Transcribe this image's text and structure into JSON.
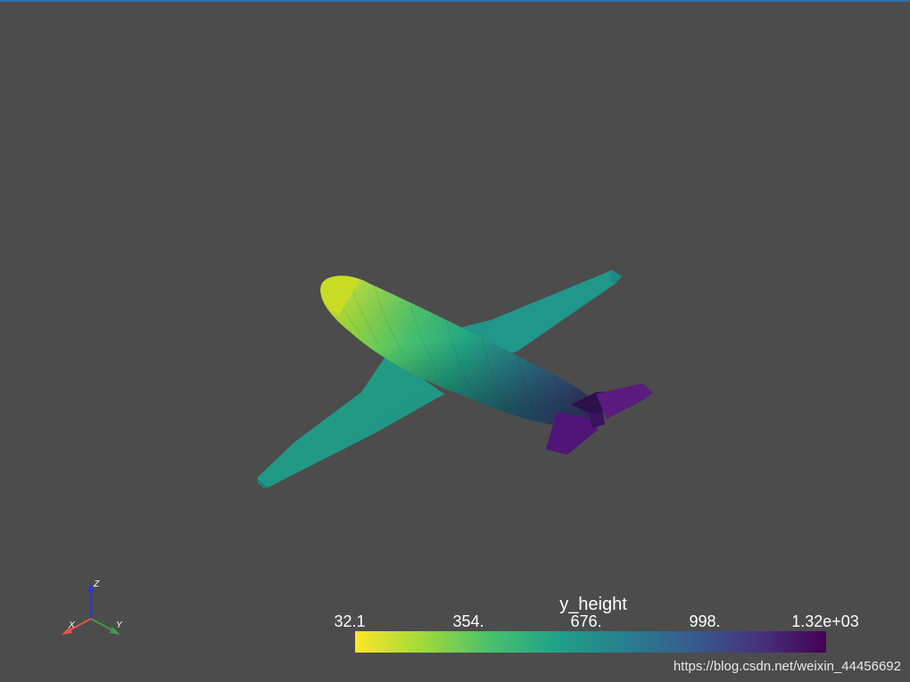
{
  "scalar_bar": {
    "title": "y_height",
    "ticks": [
      "32.1",
      "354.",
      "676.",
      "998.",
      "1.32e+03"
    ],
    "colormap": [
      "#fde725",
      "#a0da39",
      "#4ac16d",
      "#1fa187",
      "#277f8e",
      "#365c8d",
      "#46327e",
      "#440154"
    ]
  },
  "axes": {
    "x_label": "X",
    "y_label": "Y",
    "z_label": "Z",
    "x_color": "#e0584a",
    "y_color": "#3e9a4c",
    "z_color": "#2c35c8"
  },
  "background_color": "#4c4c4c",
  "watermark": "https://blog.csdn.net/weixin_44456692"
}
